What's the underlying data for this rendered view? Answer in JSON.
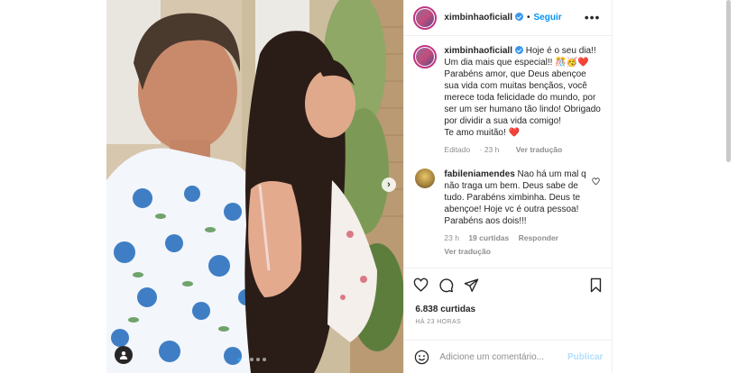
{
  "post": {
    "photo_alt": "",
    "carousel_dots": 5,
    "carousel_active_index": 0
  },
  "header": {
    "username": "ximbinhaoficiall",
    "separator": "•",
    "follow_label": "Seguir",
    "more_icon": "ellipsis-icon"
  },
  "caption": {
    "username": "ximbinhaoficiall",
    "text": "Hoje é o seu dia!! Um dia mais que especial!! 🎊🥳",
    "heart_1": "❤️",
    "text_2": "Parabéns amor, que Deus abençoe sua vida com muitas bençãos, você merece toda felicidade do mundo, por ser um ser humano tão lindo! Obrigado por dividir a sua vida comigo!",
    "text_3": "Te amo muitão!",
    "heart_2": "❤️",
    "edited_label": "Editado",
    "time": "23 h",
    "translate_label": "Ver tradução"
  },
  "comment": {
    "username": "fabileniamendes",
    "text": "Nao há um mal q não traga um bem. Deus sabe de tudo. Parabéns ximbinha. Deus te abençoe! Hoje vc é outra pessoa! Parabéns aos dois!!!",
    "time": "23 h",
    "likes": "19 curtidas",
    "reply_label": "Responder",
    "translate_label": "Ver tradução"
  },
  "actions": {
    "likes_count": "6.838 curtidas",
    "time_ago": "HÁ 23 HORAS"
  },
  "add_comment": {
    "placeholder": "Adicione um comentário...",
    "publish_label": "Publicar"
  },
  "colors": {
    "accent": "#0095f6",
    "heart": "#ed4956",
    "muted": "#8e8e8e",
    "publish_disabled": "#b2dffc"
  }
}
